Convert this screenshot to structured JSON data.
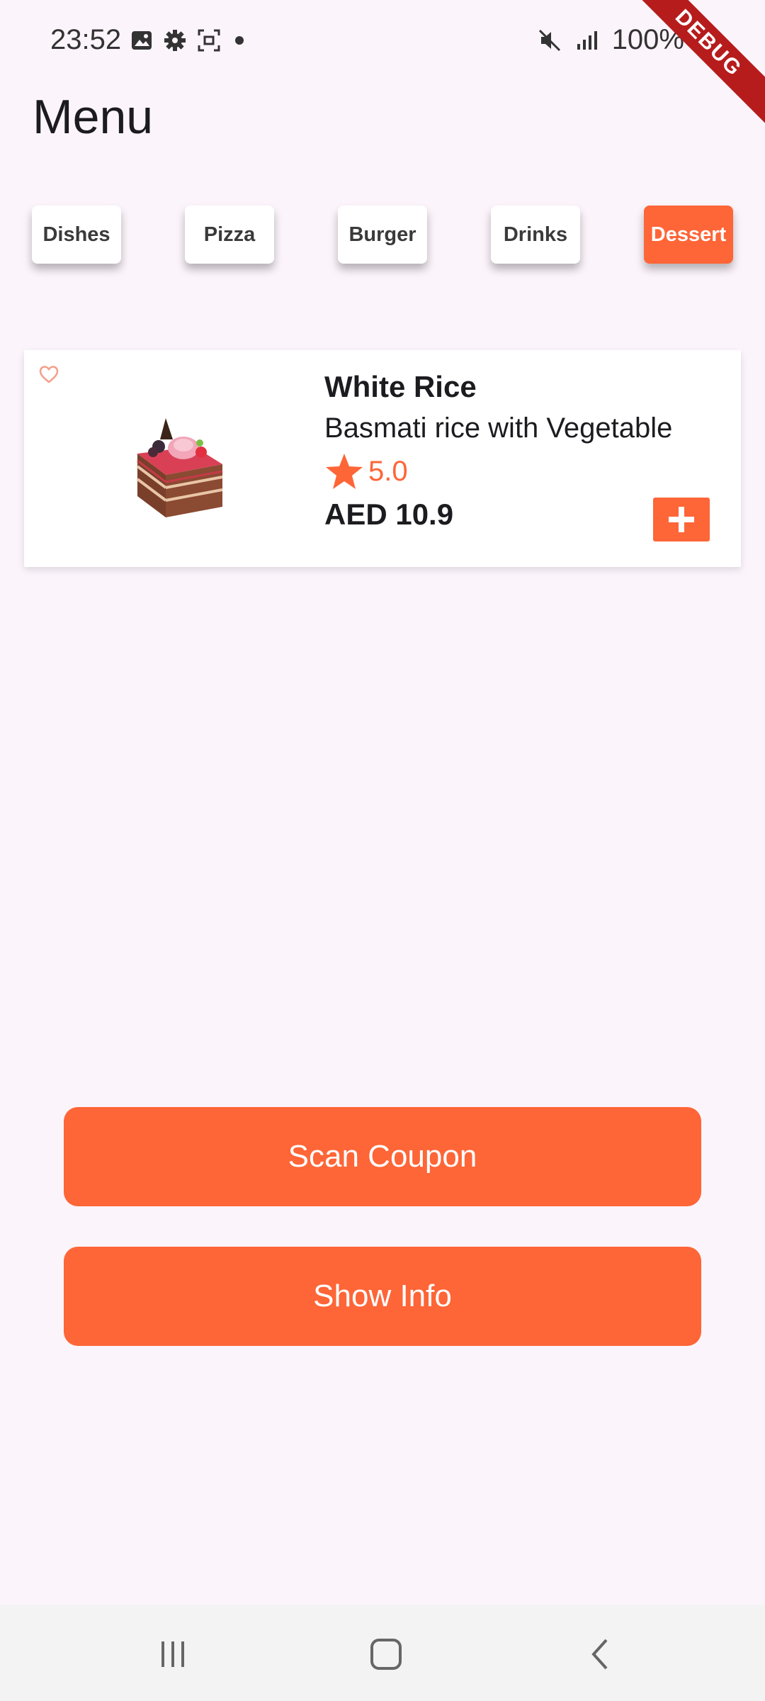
{
  "status_bar": {
    "time": "23:52",
    "battery": "100%",
    "icons_left": [
      "image-icon",
      "gear-icon",
      "screenshot-icon",
      "dot-icon"
    ],
    "icons_right": [
      "mute-icon",
      "signal-icon",
      "battery-icon"
    ]
  },
  "debug_banner": "DEBUG",
  "header": {
    "title": "Menu"
  },
  "categories": [
    {
      "label": "Dishes",
      "active": false
    },
    {
      "label": "Pizza",
      "active": false
    },
    {
      "label": "Burger",
      "active": false
    },
    {
      "label": "Drinks",
      "active": false
    },
    {
      "label": "Dessert",
      "active": true
    }
  ],
  "food_item": {
    "name": "White Rice",
    "description": "Basmati rice with Vegetable",
    "rating": "5.0",
    "price": "AED 10.9",
    "favorite": false
  },
  "actions": {
    "scan_coupon": "Scan Coupon",
    "show_info": "Show Info"
  },
  "colors": {
    "accent": "#fe6537",
    "background": "#fcf4fb",
    "card": "#ffffff"
  }
}
